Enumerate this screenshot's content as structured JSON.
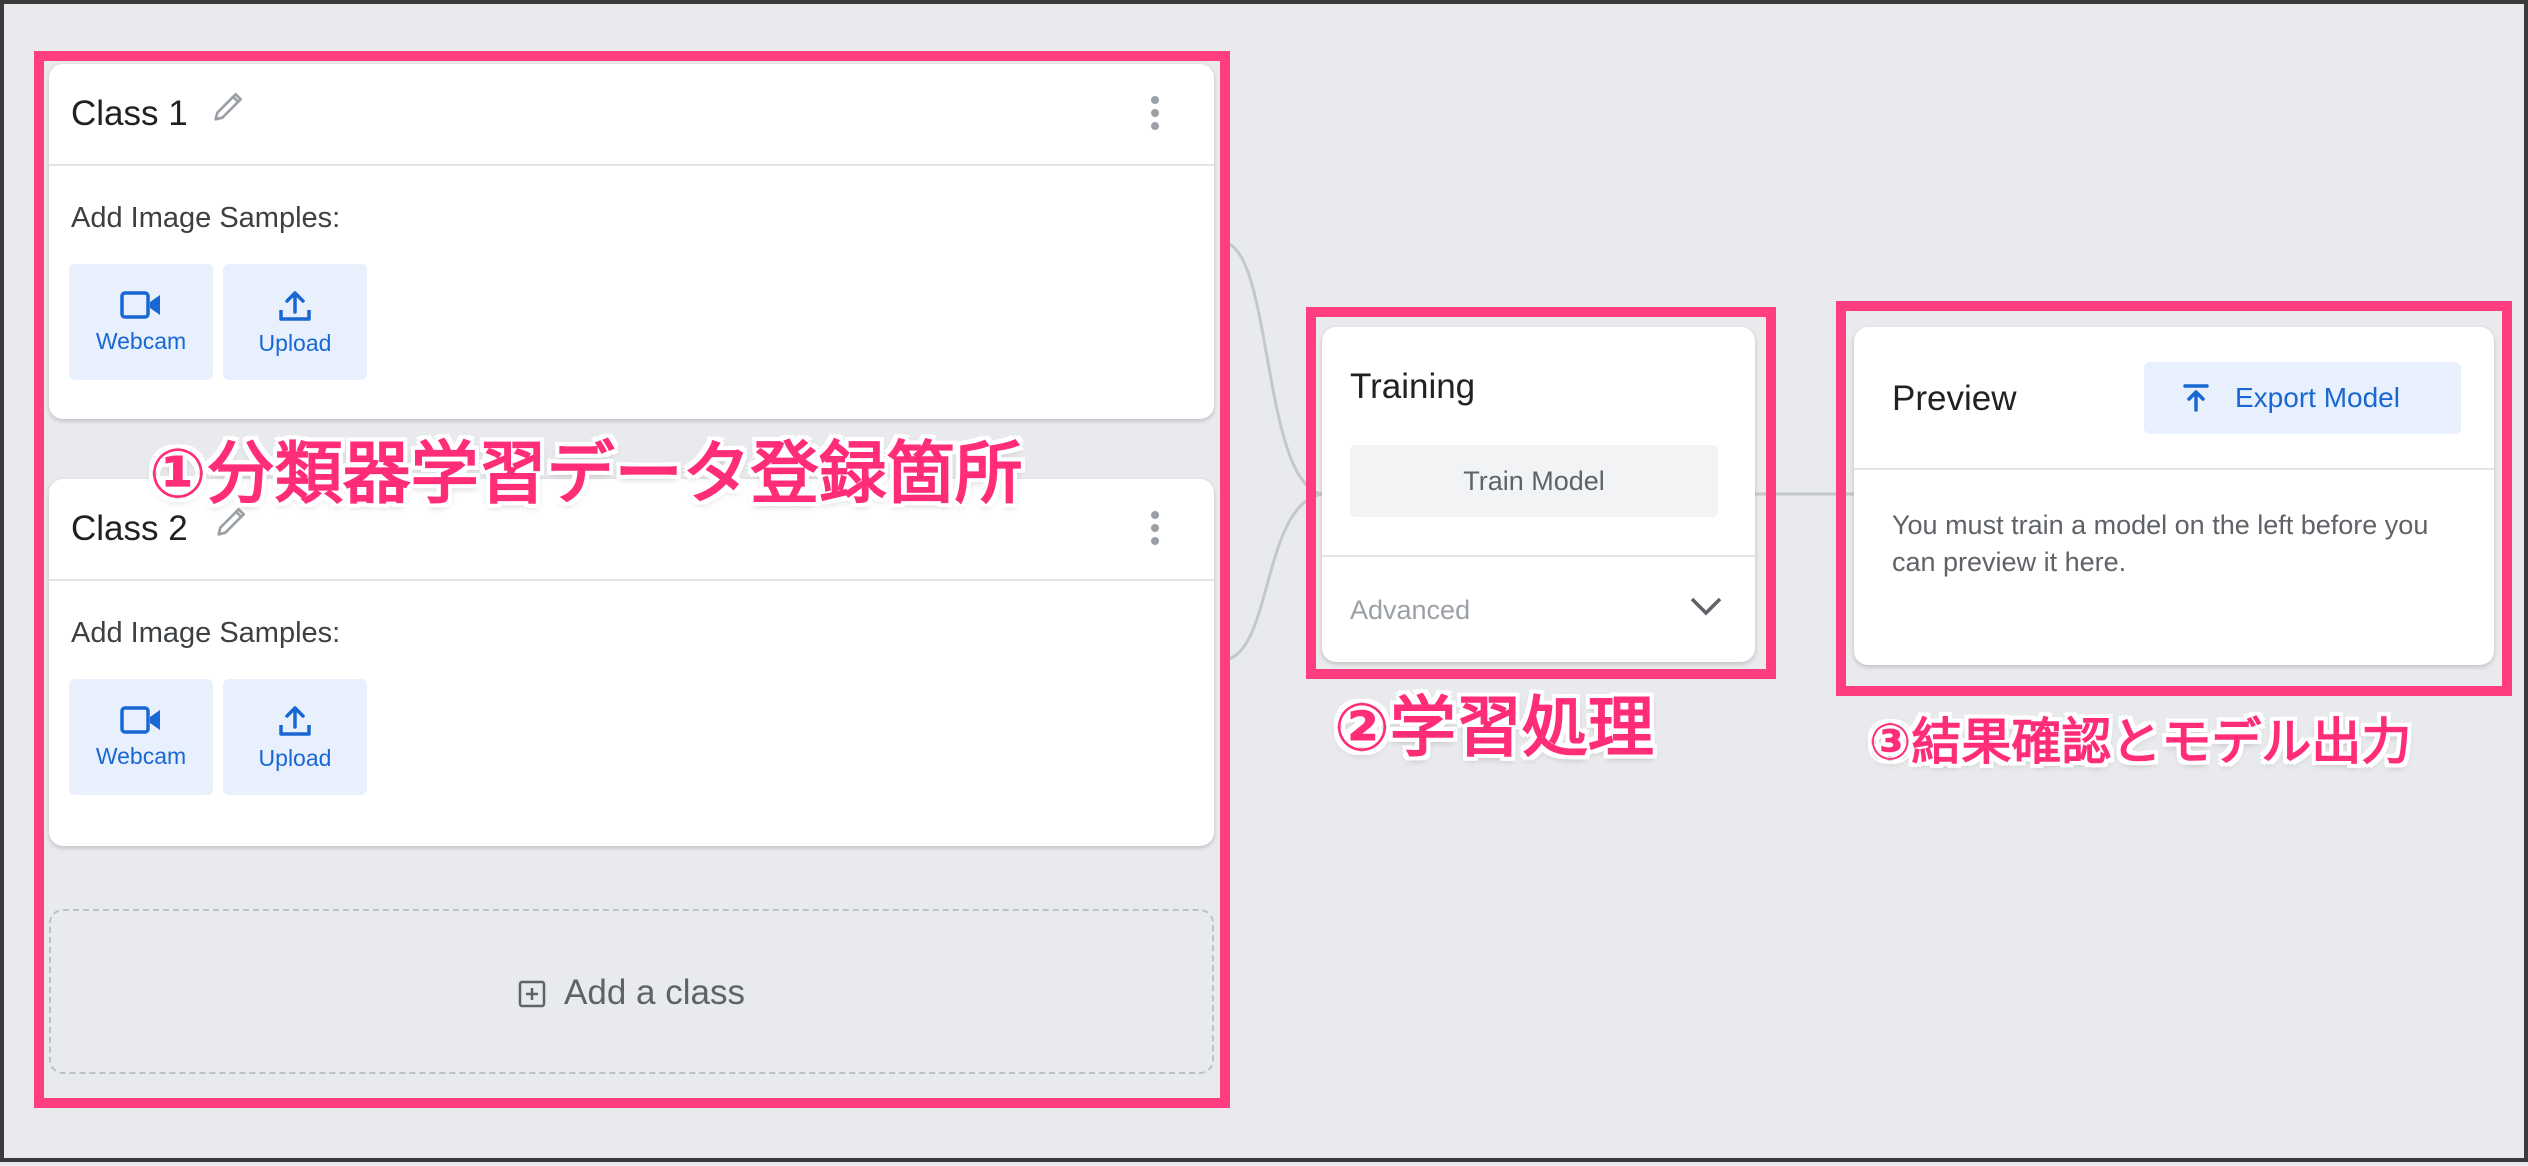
{
  "classes": [
    {
      "name": "Class 1",
      "samples_label": "Add Image Samples:",
      "webcam_label": "Webcam",
      "upload_label": "Upload"
    },
    {
      "name": "Class 2",
      "samples_label": "Add Image Samples:",
      "webcam_label": "Webcam",
      "upload_label": "Upload"
    }
  ],
  "add_class_label": "Add a class",
  "training": {
    "title": "Training",
    "train_button": "Train Model",
    "advanced_label": "Advanced"
  },
  "preview": {
    "title": "Preview",
    "export_button": "Export Model",
    "message": "You must train a model on the left before you can preview it here."
  },
  "annotations": {
    "data_section": "①分類器学習データ登録箇所",
    "training_section": "②学習処理",
    "result_section": "③結果確認とモデル出力"
  },
  "colors": {
    "highlight": "#ff3d7f",
    "accent": "#1967d2",
    "background": "#e8eaed"
  }
}
